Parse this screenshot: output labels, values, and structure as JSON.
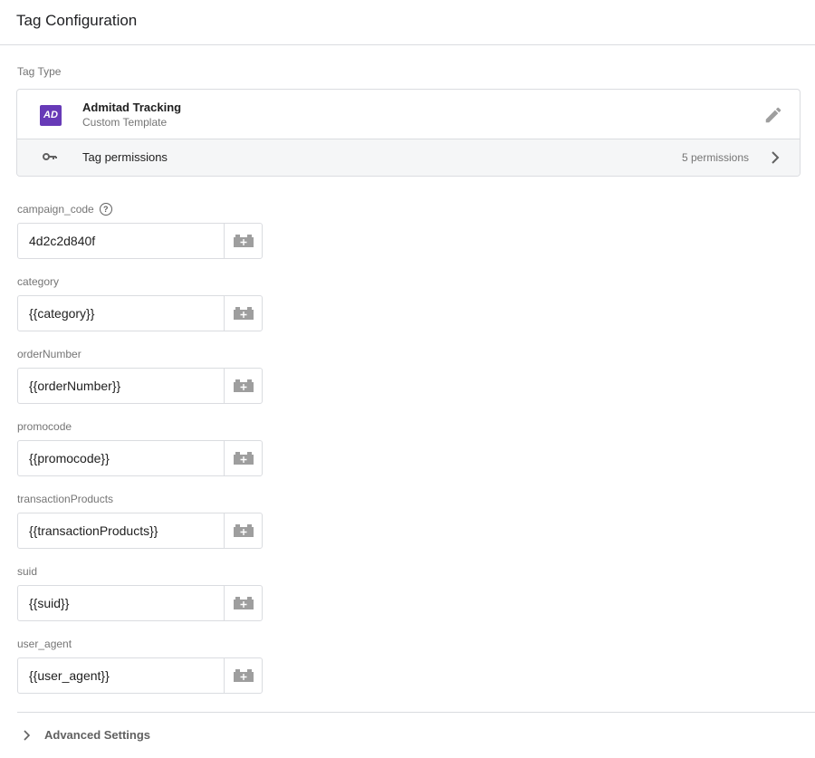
{
  "header": {
    "title": "Tag Configuration"
  },
  "tag_type": {
    "label": "Tag Type",
    "name": "Admitad Tracking",
    "subtitle": "Custom Template",
    "logo_text": "AD",
    "logo_color": "#673ab7",
    "permissions_label": "Tag permissions",
    "permissions_count": "5 permissions"
  },
  "fields": [
    {
      "label": "campaign_code",
      "value": "4d2c2d840f",
      "help": true
    },
    {
      "label": "category",
      "value": "{{category}}"
    },
    {
      "label": "orderNumber",
      "value": "{{orderNumber}}"
    },
    {
      "label": "promocode",
      "value": "{{promocode}}"
    },
    {
      "label": "transactionProducts",
      "value": "{{transactionProducts}}"
    },
    {
      "label": "suid",
      "value": "{{suid}}"
    },
    {
      "label": "user_agent",
      "value": "{{user_agent}}"
    }
  ],
  "advanced": {
    "label": "Advanced Settings"
  }
}
